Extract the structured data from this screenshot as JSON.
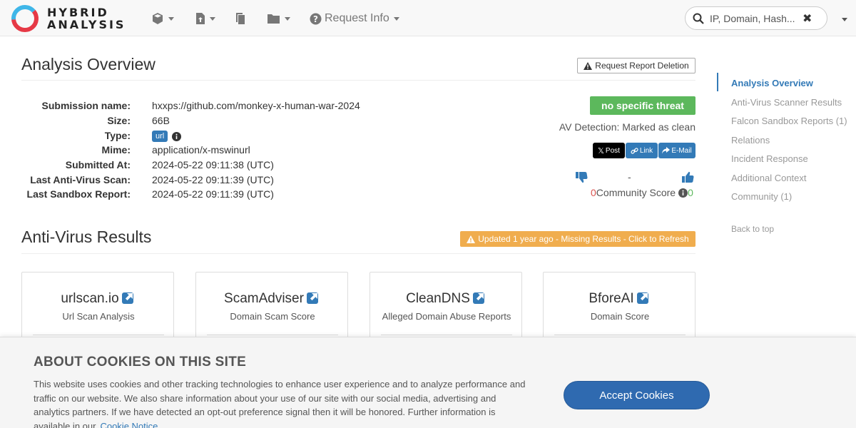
{
  "brand": {
    "line1": "HYBRID",
    "line2": "ANALYSIS"
  },
  "nav": {
    "request_info_label": "Request Info",
    "search_placeholder": "IP, Domain, Hash...",
    "clear_label": "✖"
  },
  "overview": {
    "title": "Analysis Overview",
    "delete_button": "Request Report Deletion",
    "rows": [
      {
        "key": "Submission name:",
        "value": "hxxps://github.com/monkey-x-human-war-2024"
      },
      {
        "key": "Size:",
        "value": "66B"
      },
      {
        "key": "Type:",
        "value": "url"
      },
      {
        "key": "Mime:",
        "value": "application/x-mswinurl"
      },
      {
        "key": "Submitted At:",
        "value": "2024-05-22 09:11:38 (UTC)"
      },
      {
        "key": "Last Anti-Virus Scan:",
        "value": "2024-05-22 09:11:39 (UTC)"
      },
      {
        "key": "Last Sandbox Report:",
        "value": "2024-05-22 09:11:39 (UTC)"
      }
    ],
    "threat_label": "no specific threat",
    "av_detection": "AV Detection: Marked as clean",
    "share": {
      "post": "Post",
      "link": "Link",
      "email": "E-Mail"
    },
    "vote_separator": "-",
    "community": {
      "negative": "0",
      "label": "Community Score",
      "positive": "0"
    }
  },
  "av_results": {
    "title": "Anti-Virus Results",
    "refresh_button": "Updated 1 year ago - Missing Results - Click to Refresh",
    "cards": [
      {
        "name": "urlscan.io",
        "sub": "Url Scan Analysis"
      },
      {
        "name": "ScamAdviser",
        "sub": "Domain Scam Score"
      },
      {
        "name": "CleanDNS",
        "sub": "Alleged Domain Abuse Reports"
      },
      {
        "name": "BforeAI",
        "sub": "Domain Score"
      }
    ]
  },
  "sidebar": {
    "items": [
      "Analysis Overview",
      "Anti-Virus Scanner Results",
      "Falcon Sandbox Reports (1)",
      "Relations",
      "Incident Response",
      "Additional Context",
      "Community (1)",
      "Back to top"
    ]
  },
  "cookie": {
    "title": "ABOUT COOKIES ON THIS SITE",
    "text": "This website uses cookies and other tracking technologies to enhance user experience and to analyze performance and traffic on our website. We also share information about your use of our site with our social media, advertising and analytics partners. If we have detected an opt-out preference signal then it will be honored. Further information is available in our",
    "link": "Cookie Notice",
    "accept": "Accept Cookies"
  },
  "colors": {
    "accent": "#337ab7",
    "success": "#5cb85c",
    "warning": "#f0ad4e",
    "danger": "#d9534f"
  }
}
